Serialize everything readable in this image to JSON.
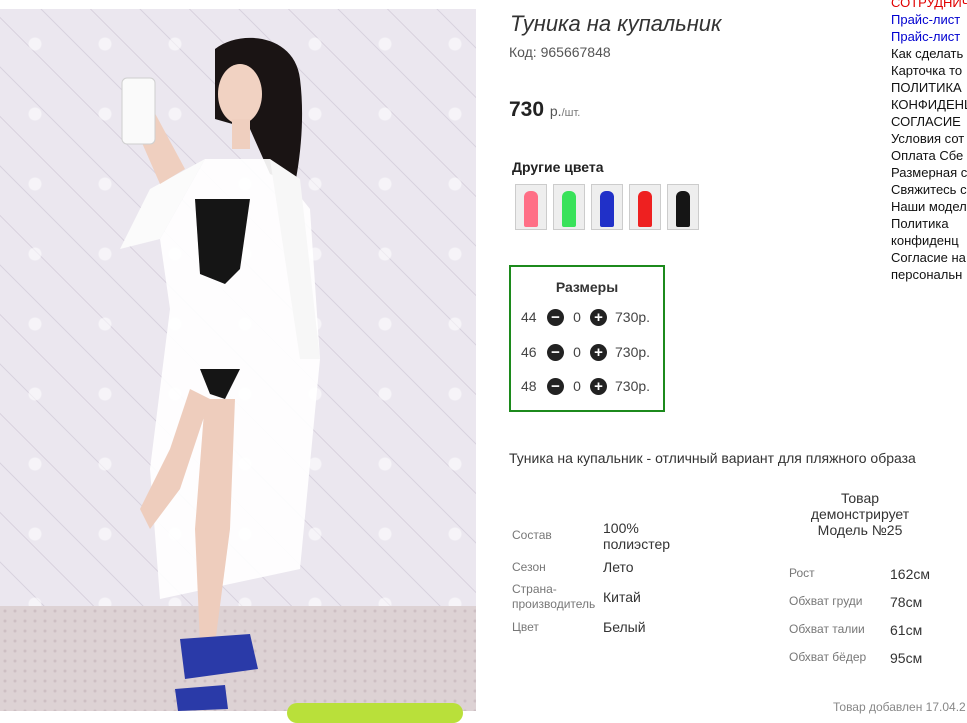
{
  "product": {
    "title": "Туника на купальник",
    "code": "Код: 965667848",
    "price": "730",
    "price_unit": "р.",
    "price_per": "/шт.",
    "other_colors_label": "Другие цвета",
    "color_swatches": [
      {
        "name": "pink",
        "color": "#ff6f86"
      },
      {
        "name": "green",
        "color": "#39e25a"
      },
      {
        "name": "blue",
        "color": "#2030c8"
      },
      {
        "name": "red",
        "color": "#ee2020"
      },
      {
        "name": "black",
        "color": "#151515"
      }
    ],
    "description": "Туника на купальник - отличный вариант для пляжного образа",
    "added": "Товар добавлен 17.04.2"
  },
  "sizes": {
    "header": "Размеры",
    "minus_icon": "minus-circle-icon",
    "plus_icon": "plus-circle-icon",
    "rows": [
      {
        "size": "44",
        "qty": "0",
        "price": "730р."
      },
      {
        "size": "46",
        "qty": "0",
        "price": "730р."
      },
      {
        "size": "48",
        "qty": "0",
        "price": "730р."
      }
    ]
  },
  "properties": [
    {
      "key": "Состав",
      "value": "100% полиэстер"
    },
    {
      "key": "Сезон",
      "value": "Лето"
    },
    {
      "key": "Страна-производитель",
      "value": "Китай"
    },
    {
      "key": "Цвет",
      "value": "Белый"
    }
  ],
  "model": {
    "caption": "Товар демонстрирует Модель №25",
    "measurements": [
      {
        "key": "Рост",
        "value": "162см"
      },
      {
        "key": "Обхват груди",
        "value": "78см"
      },
      {
        "key": "Обхват талии",
        "value": "61см"
      },
      {
        "key": "Обхват бёдер",
        "value": "95см"
      }
    ]
  },
  "sidebar": {
    "links": [
      {
        "text": "СОТРУДНИЧ",
        "style": "red"
      },
      {
        "text": "Прайс-лист",
        "style": "blue"
      },
      {
        "text": "Прайс-лист",
        "style": "blue"
      },
      {
        "text": "Как сделать",
        "style": "plain"
      },
      {
        "text": "Карточка то",
        "style": "plain"
      },
      {
        "text": "ПОЛИТИКА",
        "style": "plain"
      },
      {
        "text": "КОНФИДЕНЦ",
        "style": "plain"
      },
      {
        "text": "СОГЛАСИЕ",
        "style": "plain"
      },
      {
        "text": "Условия сот",
        "style": "plain"
      },
      {
        "text": "Оплата Сбе",
        "style": "plain"
      },
      {
        "text": "Размерная с",
        "style": "plain"
      },
      {
        "text": "Свяжитесь с",
        "style": "plain"
      },
      {
        "text": "Наши модел",
        "style": "plain"
      },
      {
        "text": "Политика",
        "style": "plain"
      },
      {
        "text": "конфиденц",
        "style": "plain"
      },
      {
        "text": "Согласие на",
        "style": "plain"
      },
      {
        "text": "персональн",
        "style": "plain"
      }
    ]
  }
}
